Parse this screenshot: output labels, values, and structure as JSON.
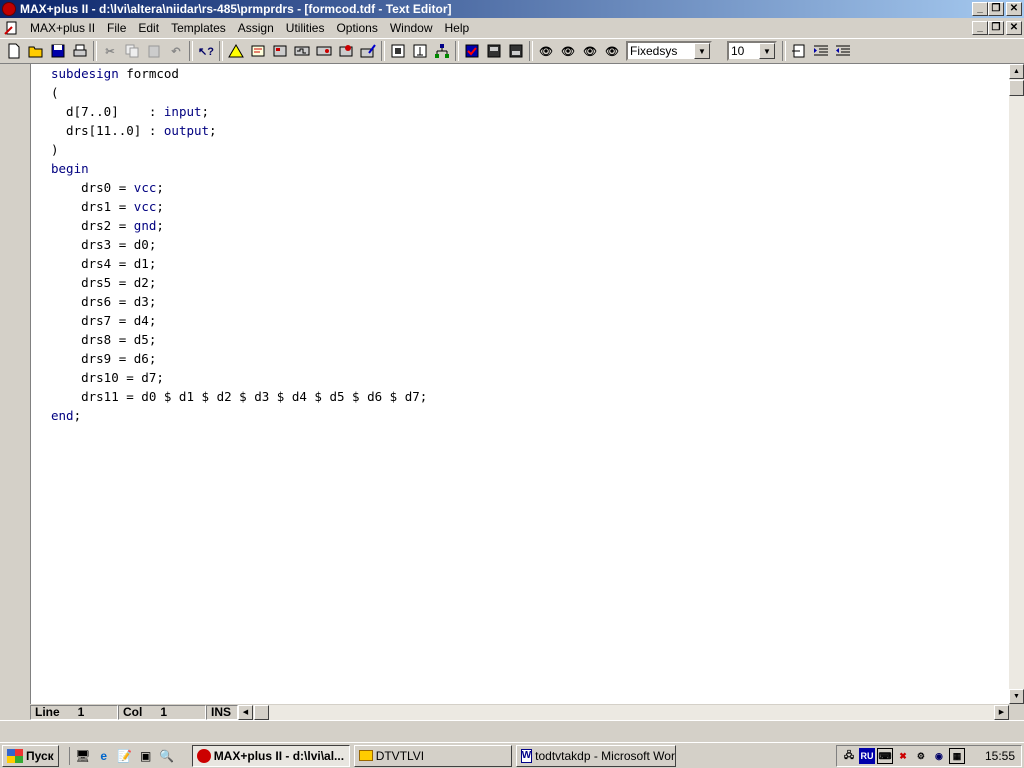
{
  "window": {
    "title": "MAX+plus II - d:\\lvi\\altera\\niidar\\rs-485\\prmprdrs - [formcod.tdf - Text Editor]"
  },
  "menu": {
    "items": [
      "MAX+plus II",
      "File",
      "Edit",
      "Templates",
      "Assign",
      "Utilities",
      "Options",
      "Window",
      "Help"
    ]
  },
  "toolbar": {
    "font_value": "Fixedsys",
    "size_value": "10"
  },
  "code": [
    [
      {
        "t": "subdesign",
        "k": true
      },
      {
        "t": " formcod",
        "k": false
      }
    ],
    [
      {
        "t": "(",
        "k": false
      }
    ],
    [
      {
        "t": "  d[7..0]    : ",
        "k": false
      },
      {
        "t": "input",
        "k": true
      },
      {
        "t": ";",
        "k": false
      }
    ],
    [
      {
        "t": "  drs[11..0] : ",
        "k": false
      },
      {
        "t": "output",
        "k": true
      },
      {
        "t": ";",
        "k": false
      }
    ],
    [
      {
        "t": ")",
        "k": false
      }
    ],
    [
      {
        "t": "begin",
        "k": true
      }
    ],
    [
      {
        "t": "    drs0 = ",
        "k": false
      },
      {
        "t": "vcc",
        "k": true
      },
      {
        "t": ";",
        "k": false
      }
    ],
    [
      {
        "t": "    drs1 = ",
        "k": false
      },
      {
        "t": "vcc",
        "k": true
      },
      {
        "t": ";",
        "k": false
      }
    ],
    [
      {
        "t": "    drs2 = ",
        "k": false
      },
      {
        "t": "gnd",
        "k": true
      },
      {
        "t": ";",
        "k": false
      }
    ],
    [
      {
        "t": "    drs3 = d0;",
        "k": false
      }
    ],
    [
      {
        "t": "    drs4 = d1;",
        "k": false
      }
    ],
    [
      {
        "t": "    drs5 = d2;",
        "k": false
      }
    ],
    [
      {
        "t": "    drs6 = d3;",
        "k": false
      }
    ],
    [
      {
        "t": "    drs7 = d4;",
        "k": false
      }
    ],
    [
      {
        "t": "    drs8 = d5;",
        "k": false
      }
    ],
    [
      {
        "t": "    drs9 = d6;",
        "k": false
      }
    ],
    [
      {
        "t": "    drs10 = d7;",
        "k": false
      }
    ],
    [
      {
        "t": "    drs11 = d0 $ d1 $ d2 $ d3 $ d4 $ d5 $ d6 $ d7;",
        "k": false
      }
    ],
    [
      {
        "t": "end",
        "k": true
      },
      {
        "t": ";",
        "k": false
      }
    ]
  ],
  "status": {
    "line_label": "Line",
    "line_value": "1",
    "col_label": "Col",
    "col_value": "1",
    "mode": "INS"
  },
  "taskbar": {
    "start_label": "Пуск",
    "tasks": [
      {
        "label": "MAX+plus II - d:\\lvi\\al...",
        "active": true
      },
      {
        "label": "DTVTLVI",
        "active": false
      },
      {
        "label": "todtvtakdp - Microsoft Word",
        "active": false
      }
    ],
    "language": "RU",
    "clock": "15:55"
  }
}
